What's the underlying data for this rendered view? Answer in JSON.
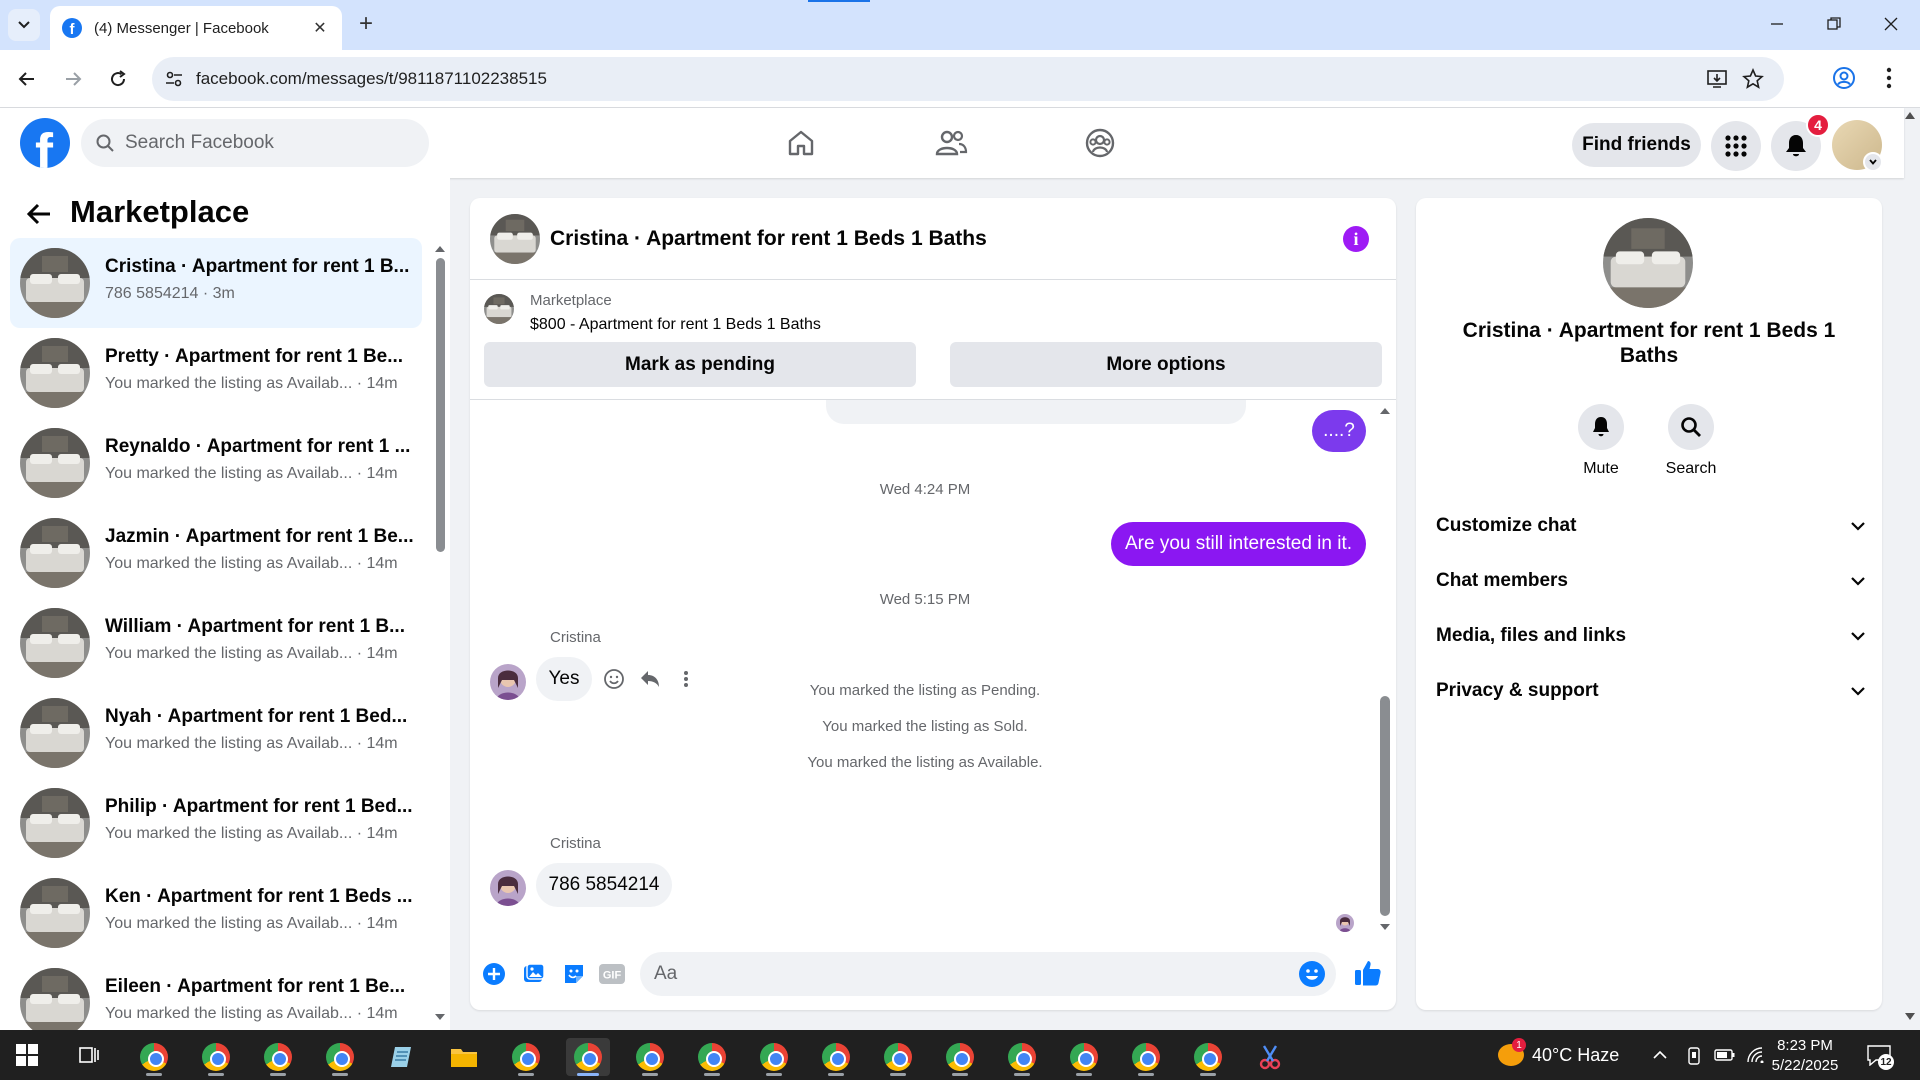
{
  "browser": {
    "tab_title": "(4) Messenger | Facebook",
    "url": "facebook.com/messages/t/9811871102238515"
  },
  "header": {
    "search_placeholder": "Search Facebook",
    "find_friends": "Find friends",
    "notification_count": "4"
  },
  "sidebar": {
    "title": "Marketplace",
    "conversations": [
      {
        "name": "Cristina · Apartment for rent 1 B...",
        "subtitle": "786 5854214 · 3m"
      },
      {
        "name": "Pretty · Apartment for rent 1 Be...",
        "subtitle": "You marked the listing as Availab... · 14m"
      },
      {
        "name": "Reynaldo · Apartment for rent 1 ...",
        "subtitle": "You marked the listing as Availab... · 14m"
      },
      {
        "name": "Jazmin · Apartment for rent 1 Be...",
        "subtitle": "You marked the listing as Availab... · 14m"
      },
      {
        "name": "William · Apartment for rent 1 B...",
        "subtitle": "You marked the listing as Availab... · 14m"
      },
      {
        "name": "Nyah · Apartment for rent 1 Bed...",
        "subtitle": "You marked the listing as Availab... · 14m"
      },
      {
        "name": "Philip · Apartment for rent 1 Bed...",
        "subtitle": "You marked the listing as Availab... · 14m"
      },
      {
        "name": "Ken · Apartment for rent 1 Beds ...",
        "subtitle": "You marked the listing as Availab... · 14m"
      },
      {
        "name": "Eileen · Apartment for rent 1 Be...",
        "subtitle": "You marked the listing as Availab... · 14m"
      }
    ]
  },
  "chat": {
    "title": "Cristina · Apartment for rent 1 Beds 1 Baths",
    "listing_source": "Marketplace",
    "listing_title": "$800 - Apartment for rent 1 Beds 1 Baths",
    "mark_pending": "Mark as pending",
    "more_options": "More options",
    "messages": {
      "out_1": "....?",
      "time_1": "Wed 4:24 PM",
      "out_2": "Are you still interested in it.",
      "time_2": "Wed 5:15 PM",
      "sender_1": "Cristina",
      "in_1": "Yes",
      "status_1": "You marked the listing as Pending.",
      "status_2": "You marked the listing as Sold.",
      "status_3": "You marked the listing as Available.",
      "sender_2": "Cristina",
      "in_2": "786 5854214"
    },
    "composer_placeholder": "Aa"
  },
  "details": {
    "name": "Cristina · Apartment for rent 1 Beds 1 Baths",
    "mute": "Mute",
    "search": "Search",
    "sections": [
      "Customize chat",
      "Chat members",
      "Media, files and links",
      "Privacy & support"
    ]
  },
  "taskbar": {
    "weather_badge": "1",
    "weather": "40°C  Haze",
    "time": "8:23 PM",
    "date": "5/22/2025",
    "notification_count": "12"
  },
  "colors": {
    "facebook_blue": "#1877f2",
    "messenger_purple": "#8b17f2",
    "active_conversation": "#ebf5ff"
  }
}
